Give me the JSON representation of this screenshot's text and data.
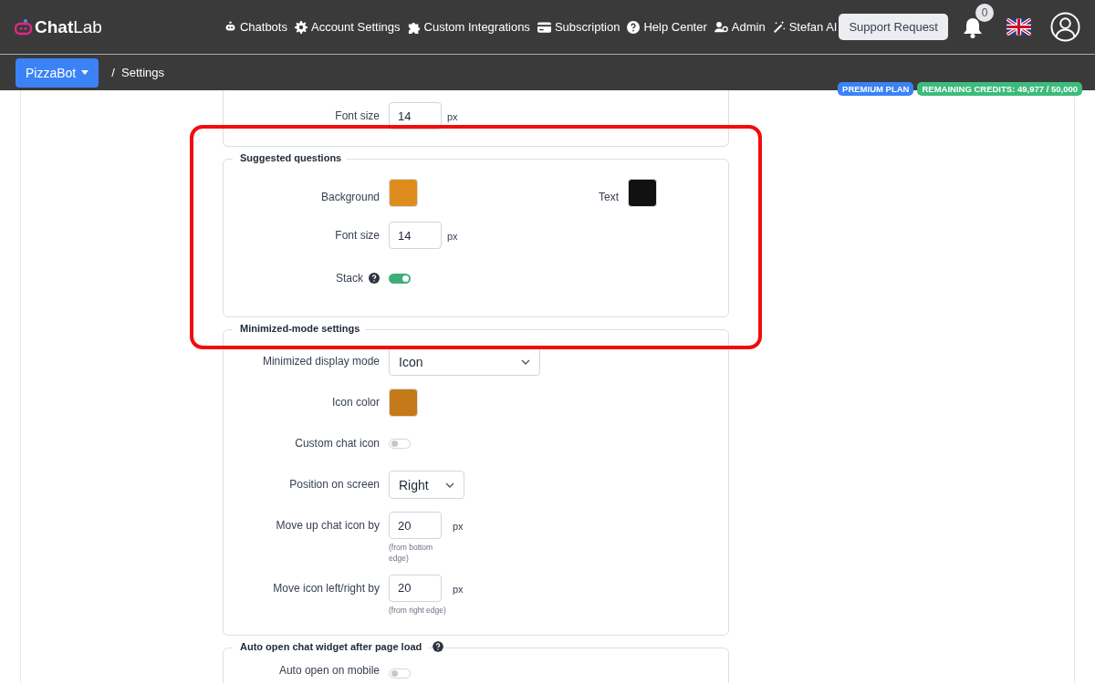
{
  "brand": {
    "name_bold": "Chat",
    "name_light": "Lab"
  },
  "nav": [
    {
      "label": "Chatbots"
    },
    {
      "label": "Account Settings"
    },
    {
      "label": "Custom Integrations"
    },
    {
      "label": "Subscription"
    },
    {
      "label": "Help Center"
    },
    {
      "label": "Admin"
    },
    {
      "label": "Stefan AI"
    }
  ],
  "support_button": "Support Request",
  "notifications": {
    "count": "0"
  },
  "bot_selector": "PizzaBot",
  "breadcrumb": "/  Settings",
  "badges": [
    {
      "label": "PREMIUM PLAN",
      "color": "#3b82f6"
    },
    {
      "label": "REMAINING CREDITS: 49,977 / 50,000",
      "color": "#3dbb7c"
    }
  ],
  "sections": [
    {
      "cut_top": true,
      "highlighted": false,
      "rows": [
        {
          "kind": "number",
          "label": "Font size",
          "value": "14",
          "unit": "px"
        }
      ]
    },
    {
      "title": "Suggested questions",
      "highlighted": true,
      "rows": [
        {
          "kind": "color_pair",
          "items": [
            {
              "label": "Background",
              "color": "#de8c1e"
            },
            {
              "label": "Text",
              "color": "#111111"
            }
          ]
        },
        {
          "kind": "number",
          "label": "Font size",
          "value": "14",
          "unit": "px"
        },
        {
          "kind": "toggle",
          "label": "Stack",
          "help": true,
          "on": true
        }
      ]
    },
    {
      "title": "Minimized-mode settings",
      "highlighted": false,
      "rows": [
        {
          "kind": "select",
          "label": "Minimized display mode",
          "value": "Icon",
          "wide": true
        },
        {
          "kind": "color",
          "label": "Icon color",
          "color": "#c47a18"
        },
        {
          "kind": "toggle",
          "label": "Custom chat icon",
          "help": false,
          "on": false
        },
        {
          "kind": "select",
          "label": "Position on screen",
          "value": "Right",
          "wide": false
        },
        {
          "kind": "number",
          "label": "Move up chat icon by",
          "value": "20",
          "unit": "px",
          "hint": "(from bottom edge)"
        },
        {
          "kind": "number",
          "label": "Move icon left/right by",
          "value": "20",
          "unit": "px",
          "hint": "(from right edge)"
        }
      ]
    },
    {
      "title": "Auto open chat widget after page load",
      "help": true,
      "highlighted": false,
      "rows": [
        {
          "kind": "toggle",
          "label": "Auto open on mobile",
          "help": false,
          "on": false
        }
      ]
    }
  ]
}
